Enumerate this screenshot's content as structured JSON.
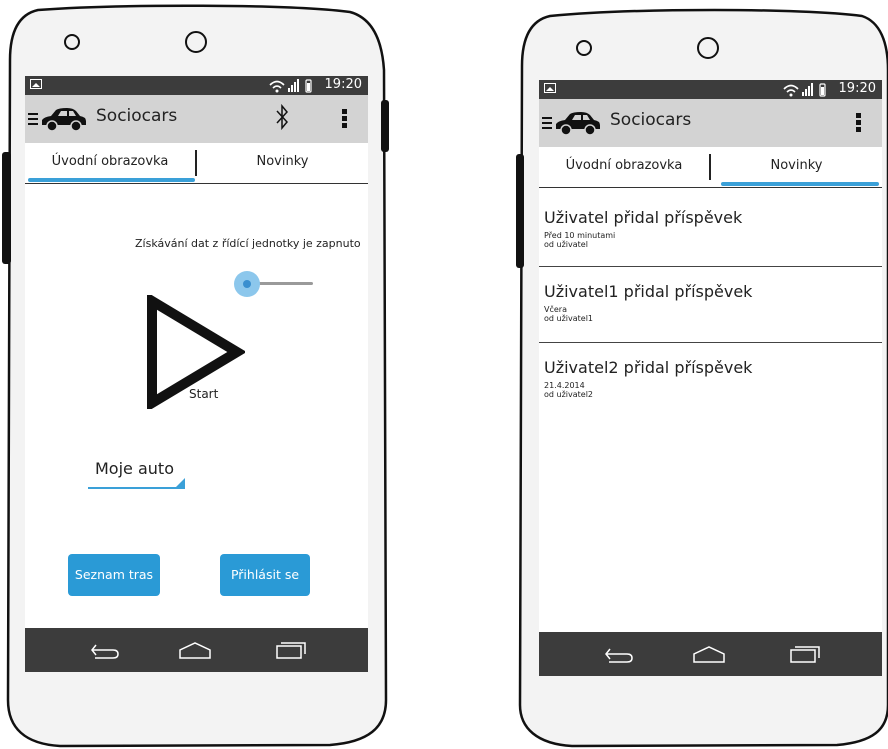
{
  "status_bar": {
    "time": "19:20"
  },
  "app": {
    "title": "Sociocars"
  },
  "tabs": {
    "home": "Úvodní obrazovka",
    "news": "Novinky"
  },
  "home": {
    "data_toggle_label": "Získávání dat z řídící jednotky je zapnuto",
    "start_label": "Start",
    "car_select_value": "Moje auto",
    "routes_button": "Seznam tras",
    "login_button": "Přihlásit se"
  },
  "news": {
    "items": [
      {
        "title": "Uživatel přidal příspěvek",
        "time": "Před 10 minutami",
        "author": "od uživatel"
      },
      {
        "title": "Uživatel1 přidal příspěvek",
        "time": "Včera",
        "author": "od uživatel1"
      },
      {
        "title": "Uživatel2 přidal příspěvek",
        "time": "21.4.2014",
        "author": "od uživatel2"
      }
    ]
  },
  "colors": {
    "accent": "#3aa0d8",
    "button": "#2a9ad6",
    "status_bar": "#3c3c3c",
    "action_bar": "#d3d3d3"
  },
  "icons": [
    "menu-icon",
    "car-icon",
    "bluetooth-icon",
    "overflow-menu-icon",
    "back-icon",
    "home-icon",
    "recent-apps-icon",
    "wifi-icon",
    "signal-icon",
    "battery-icon",
    "image-notification-icon",
    "play-icon"
  ]
}
